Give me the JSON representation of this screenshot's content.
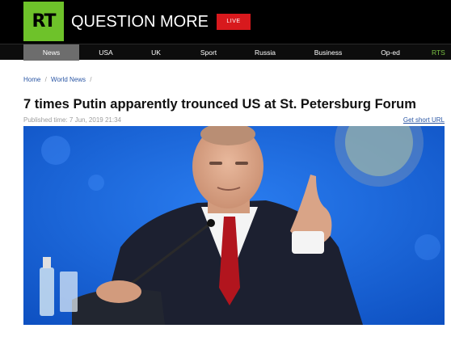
{
  "header": {
    "logo_text": "RT",
    "brand": "QUESTION MORE",
    "live_label": "LIVE",
    "brand_color": "#6ec22a",
    "live_color": "#d8191d"
  },
  "nav": {
    "items": [
      "News",
      "USA",
      "UK",
      "Sport",
      "Russia",
      "Business",
      "Op-ed",
      "RTS"
    ],
    "active": "News"
  },
  "breadcrumb": {
    "home": "Home",
    "section": "World News",
    "separator": "/"
  },
  "article": {
    "title": "7 times Putin apparently trounced US at St. Petersburg Forum",
    "published": "Published time: 7 Jun, 2019 21:34",
    "short_url_label": "Get short URL",
    "image": {
      "description_icon": "photo-of-speaker-at-forum",
      "background_color": "#1565d8"
    }
  }
}
